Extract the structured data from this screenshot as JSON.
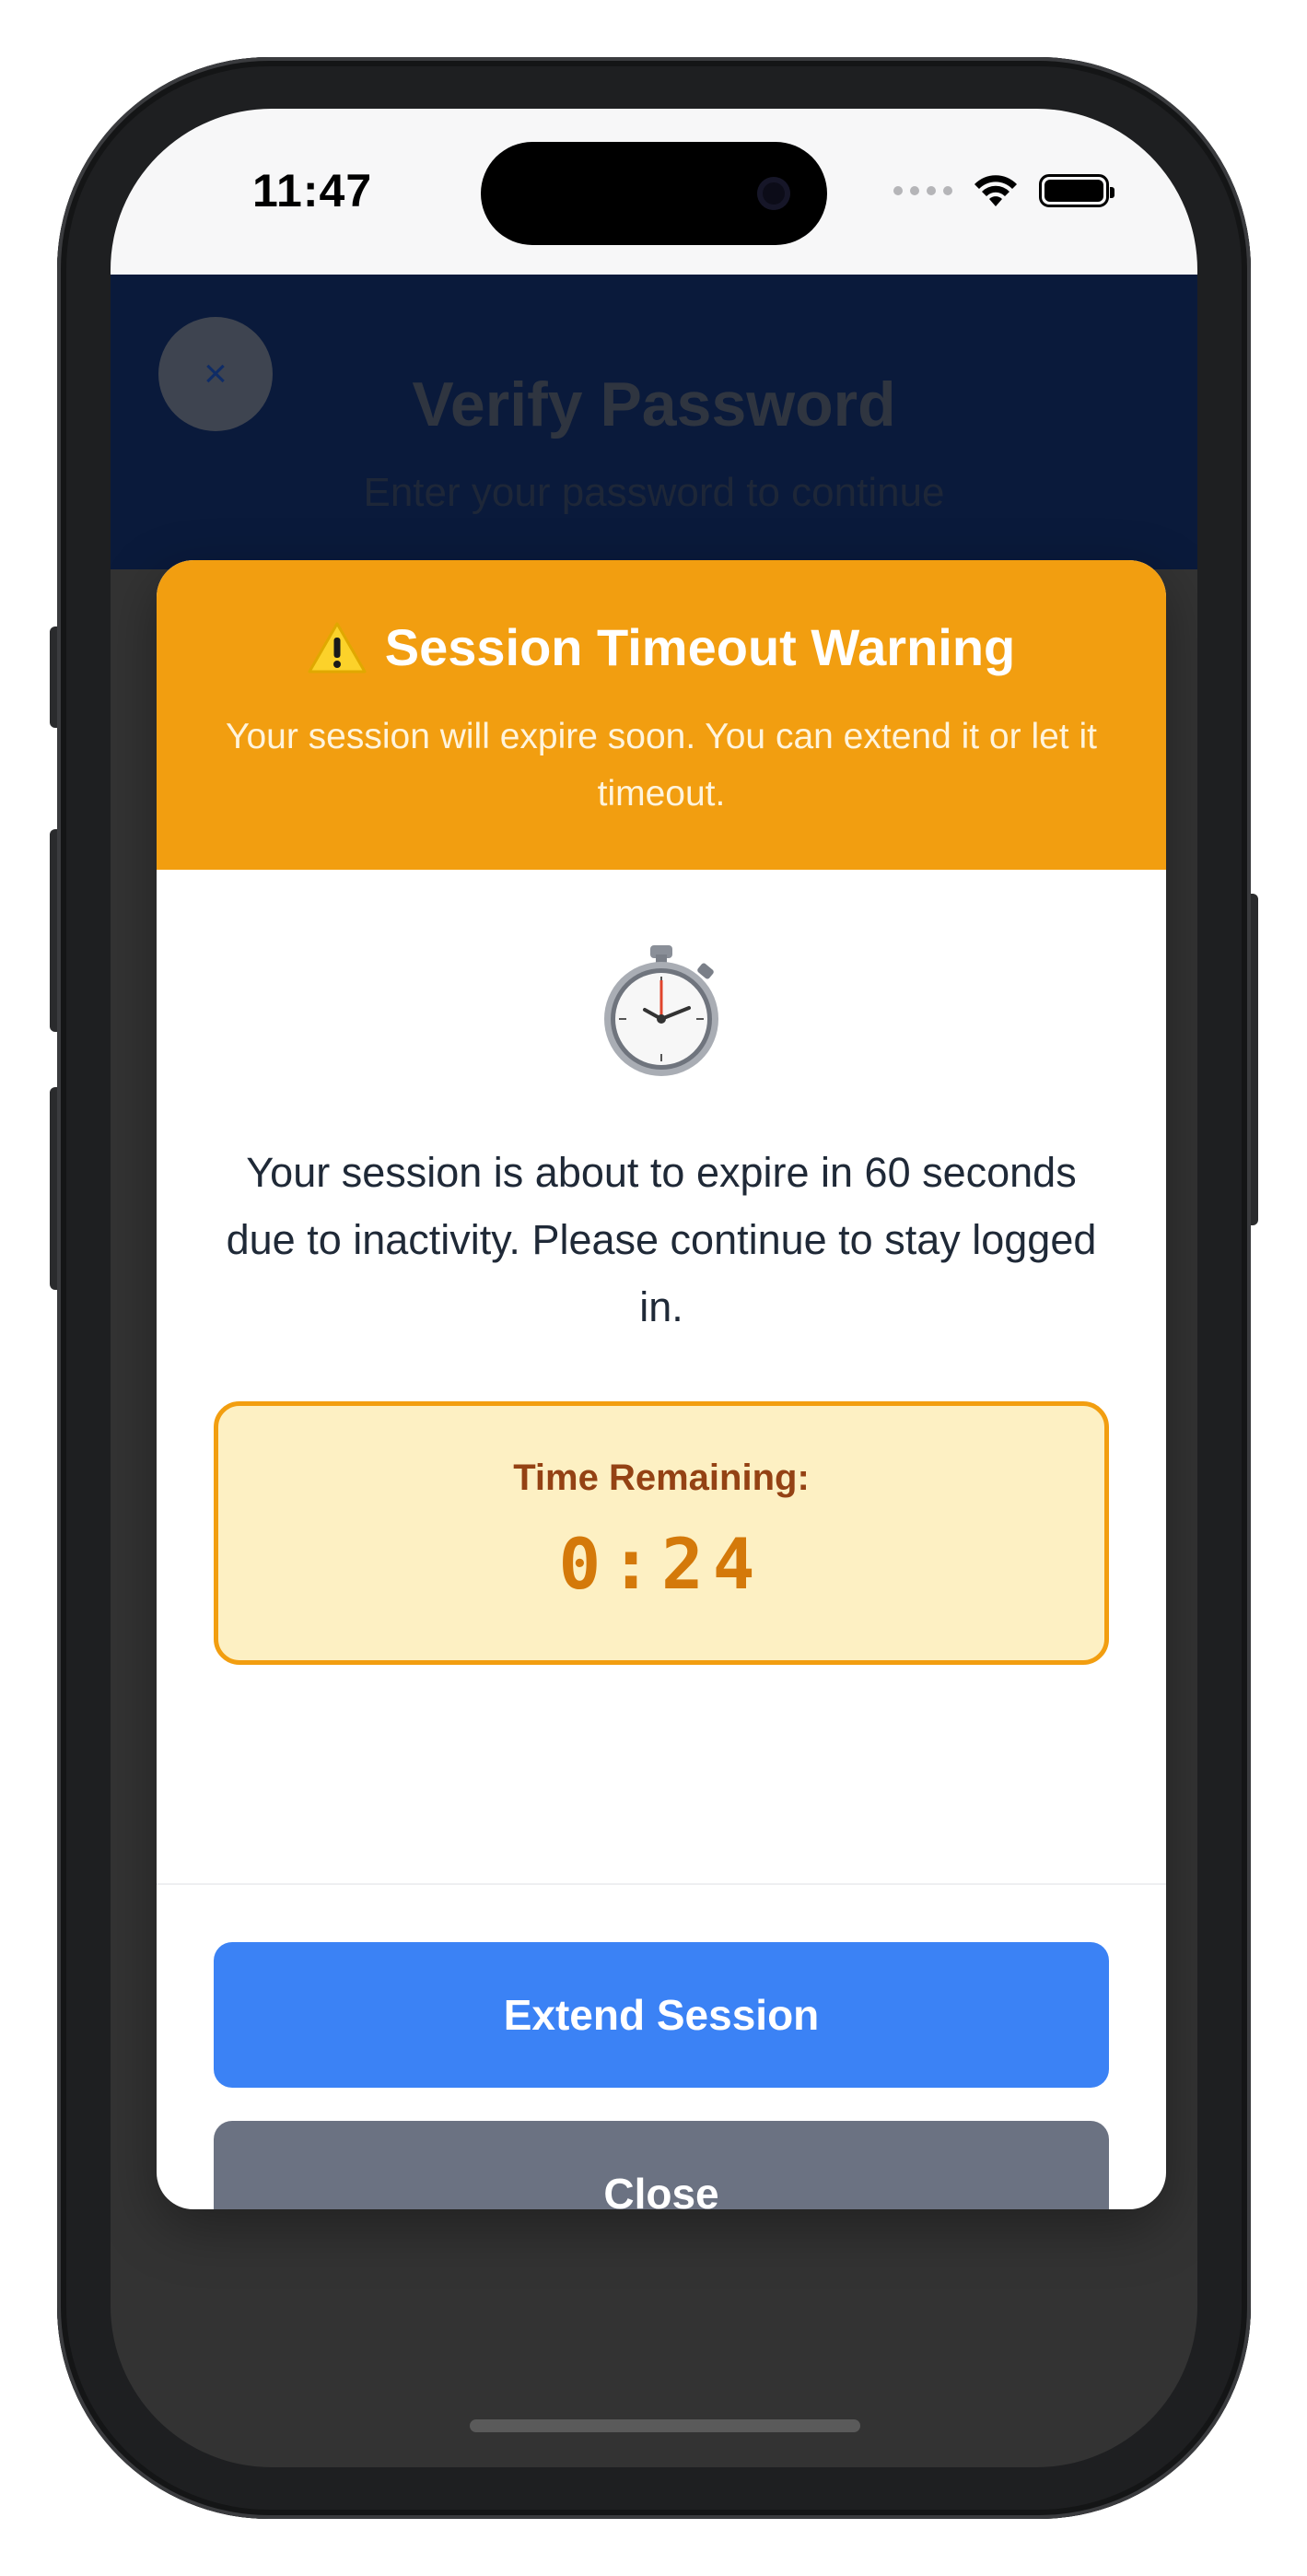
{
  "status_bar": {
    "time": "11:47",
    "icons": [
      "cellular-signal-icon",
      "wifi-icon",
      "battery-icon"
    ]
  },
  "background_screen": {
    "close_icon": "×",
    "title": "Verify Password",
    "subtitle": "Enter your password to continue"
  },
  "modal": {
    "header": {
      "icon": "warning-icon",
      "title": "Session Timeout Warning",
      "subtitle": "Your session will expire soon. You can extend it or let it timeout."
    },
    "body": {
      "icon": "stopwatch-icon",
      "message": "Your session is about to expire in 60 seconds due to inactivity. Please continue to stay logged in.",
      "timer_label": "Time Remaining:",
      "timer_value": "0:24"
    },
    "buttons": {
      "extend_label": "Extend Session",
      "close_label": "Close"
    }
  },
  "colors": {
    "warning_orange": "#f29e10",
    "timer_background": "#fdf0c3",
    "timer_text": "#d4790a",
    "primary_blue": "#3b82f5",
    "secondary_gray": "#6b7282",
    "header_navy": "#0a1a3b"
  }
}
